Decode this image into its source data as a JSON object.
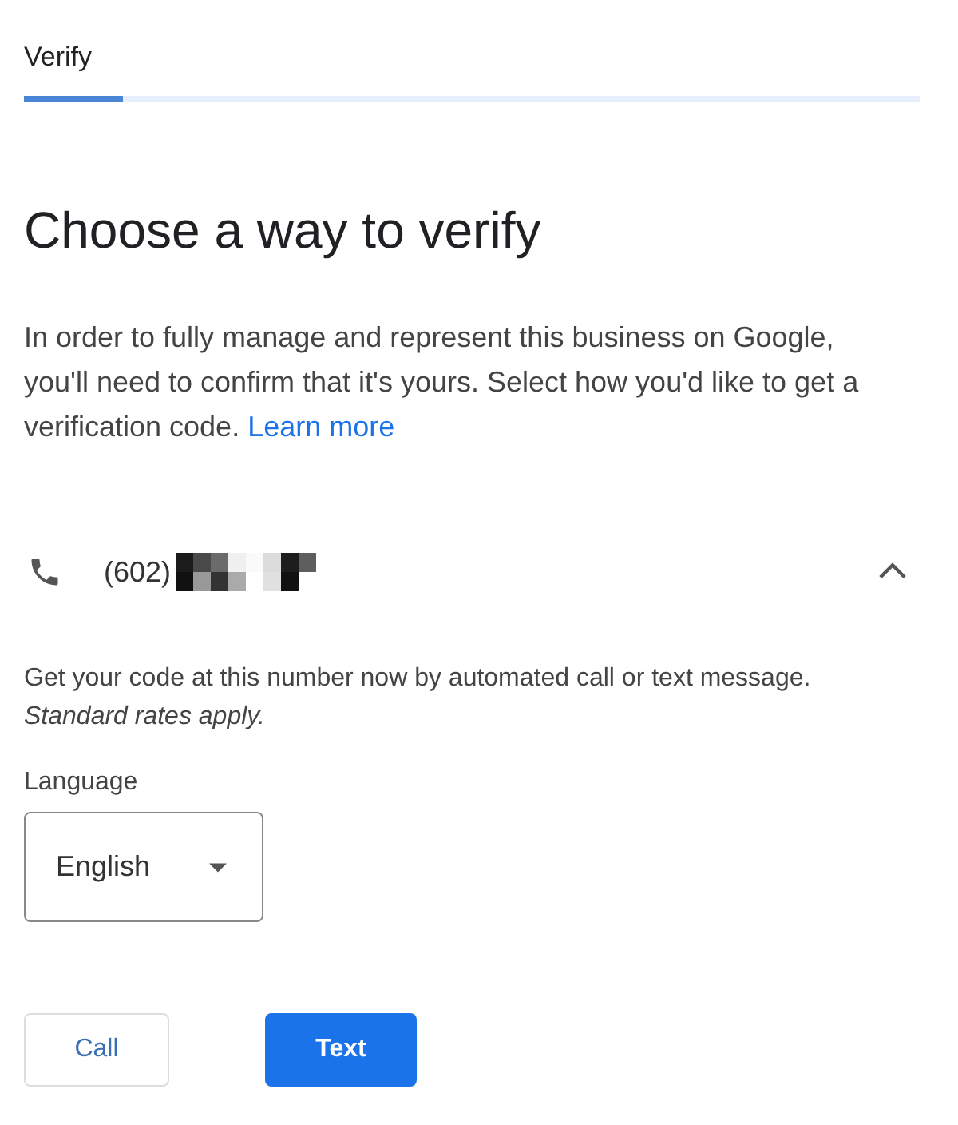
{
  "header": {
    "title": "Verify",
    "progress": {
      "level": 0.11
    }
  },
  "heading": "Choose a way to verify",
  "intro": {
    "text": "In order to fully manage and represent this business on Google, you'll need to confirm that it's yours. Select how you'd like to get a verification code.",
    "link": "Learn more"
  },
  "method": {
    "phone": "(602)",
    "expanded": true,
    "description": "Get your code at this number now by automated call or text message.",
    "note": "Standard rates apply.",
    "language": {
      "label": "Language",
      "value": "English"
    }
  },
  "buttons": [
    {
      "label": "Call",
      "kind": "outlined"
    },
    {
      "label": "Text",
      "kind": "filled"
    }
  ]
}
